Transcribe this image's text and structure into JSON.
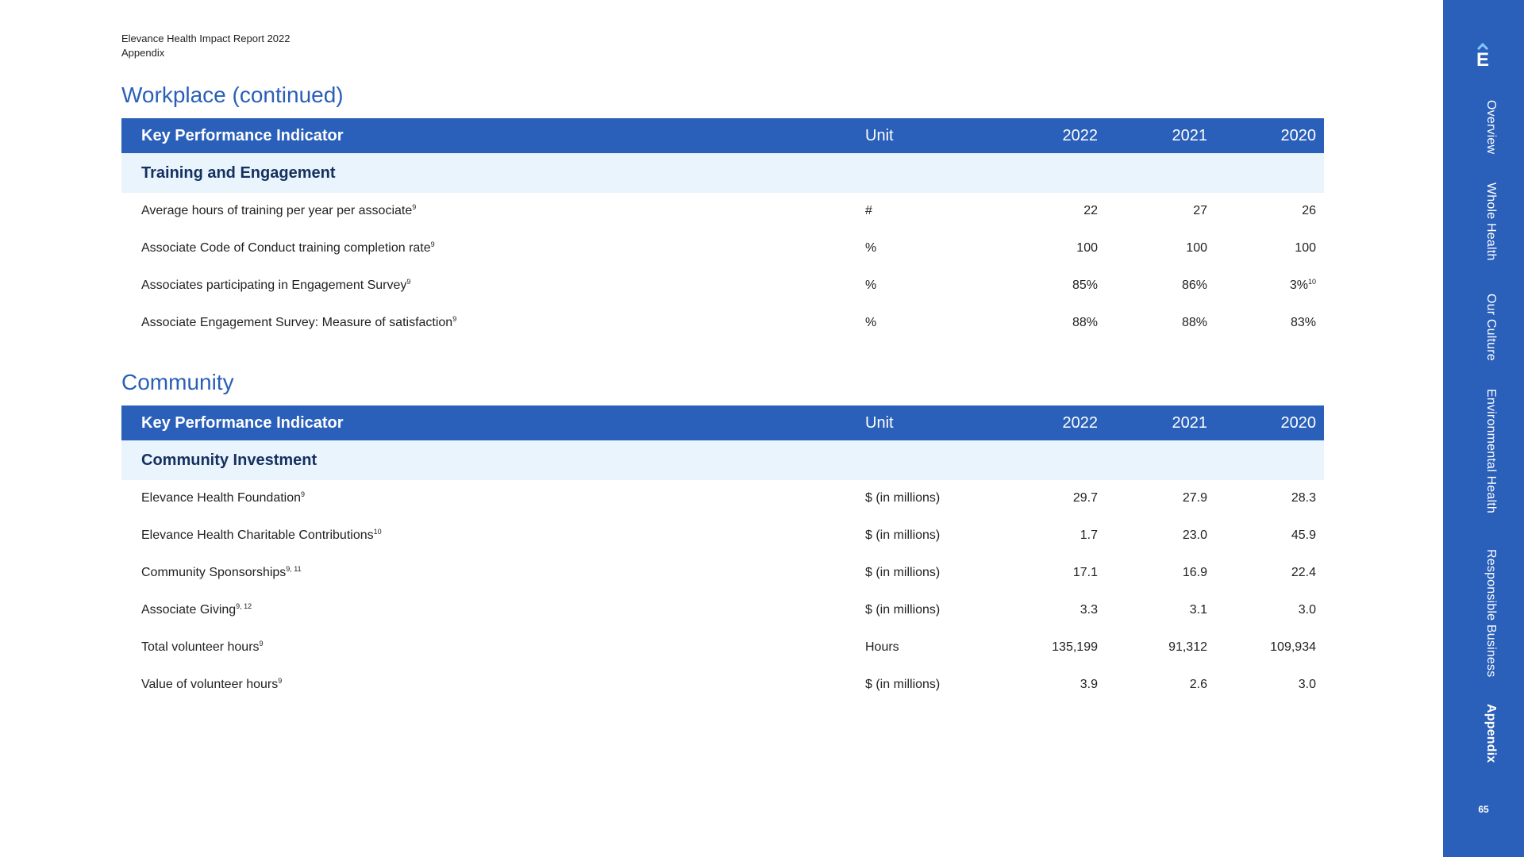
{
  "header": {
    "report_title": "Elevance Health Impact Report 2022",
    "section": "Appendix"
  },
  "workplace": {
    "title": "Workplace (continued)",
    "columns": {
      "kpi": "Key Performance Indicator",
      "unit": "Unit",
      "y1": "2022",
      "y2": "2021",
      "y3": "2020"
    },
    "subheader": "Training and Engagement",
    "rows": [
      {
        "kpi": "Average hours of training per year per associate",
        "sup": "9",
        "unit": "#",
        "y1": "22",
        "y2": "27",
        "y3": "26",
        "y3sup": ""
      },
      {
        "kpi": "Associate Code of Conduct training completion rate",
        "sup": "9",
        "unit": "%",
        "y1": "100",
        "y2": "100",
        "y3": "100",
        "y3sup": ""
      },
      {
        "kpi": "Associates participating in Engagement Survey",
        "sup": "9",
        "unit": "%",
        "y1": "85%",
        "y2": "86%",
        "y3": "3%",
        "y3sup": "10"
      },
      {
        "kpi": "Associate Engagement Survey: Measure of satisfaction",
        "sup": "9",
        "unit": "%",
        "y1": "88%",
        "y2": "88%",
        "y3": "83%",
        "y3sup": ""
      }
    ]
  },
  "community": {
    "title": "Community",
    "columns": {
      "kpi": "Key Performance Indicator",
      "unit": "Unit",
      "y1": "2022",
      "y2": "2021",
      "y3": "2020"
    },
    "subheader": "Community Investment",
    "rows": [
      {
        "kpi": "Elevance Health Foundation",
        "sup": "9",
        "unit": "$ (in millions)",
        "y1": "29.7",
        "y2": "27.9",
        "y3": "28.3"
      },
      {
        "kpi": "Elevance Health Charitable Contributions",
        "sup": "10",
        "unit": "$ (in millions)",
        "y1": "1.7",
        "y2": "23.0",
        "y3": "45.9"
      },
      {
        "kpi": "Community Sponsorships",
        "sup": "9, 11",
        "unit": "$ (in millions)",
        "y1": "17.1",
        "y2": "16.9",
        "y3": "22.4"
      },
      {
        "kpi": "Associate Giving",
        "sup": "9, 12",
        "unit": "$ (in millions)",
        "y1": "3.3",
        "y2": "3.1",
        "y3": "3.0"
      },
      {
        "kpi": "Total volunteer hours",
        "sup": "9",
        "unit": "Hours",
        "y1": "135,199",
        "y2": "91,312",
        "y3": "109,934"
      },
      {
        "kpi": "Value of volunteer hours",
        "sup": "9",
        "unit": "$ (in millions)",
        "y1": "3.9",
        "y2": "2.6",
        "y3": "3.0"
      }
    ]
  },
  "sidebar": {
    "logo": "E",
    "logo_icon": "elevance-logo-icon",
    "nav": [
      "Overview",
      "Whole Health",
      "Our Culture",
      "Environmental Health",
      "Responsible Business",
      "Appendix"
    ],
    "active": "Appendix",
    "page_number": "65",
    "background_color": "#2a5fba"
  },
  "colors": {
    "title": "#2a5fb8",
    "table_header": "#2a5fba",
    "subheader_bg": "#eaf4fc",
    "subheader_text": "#14305f"
  }
}
